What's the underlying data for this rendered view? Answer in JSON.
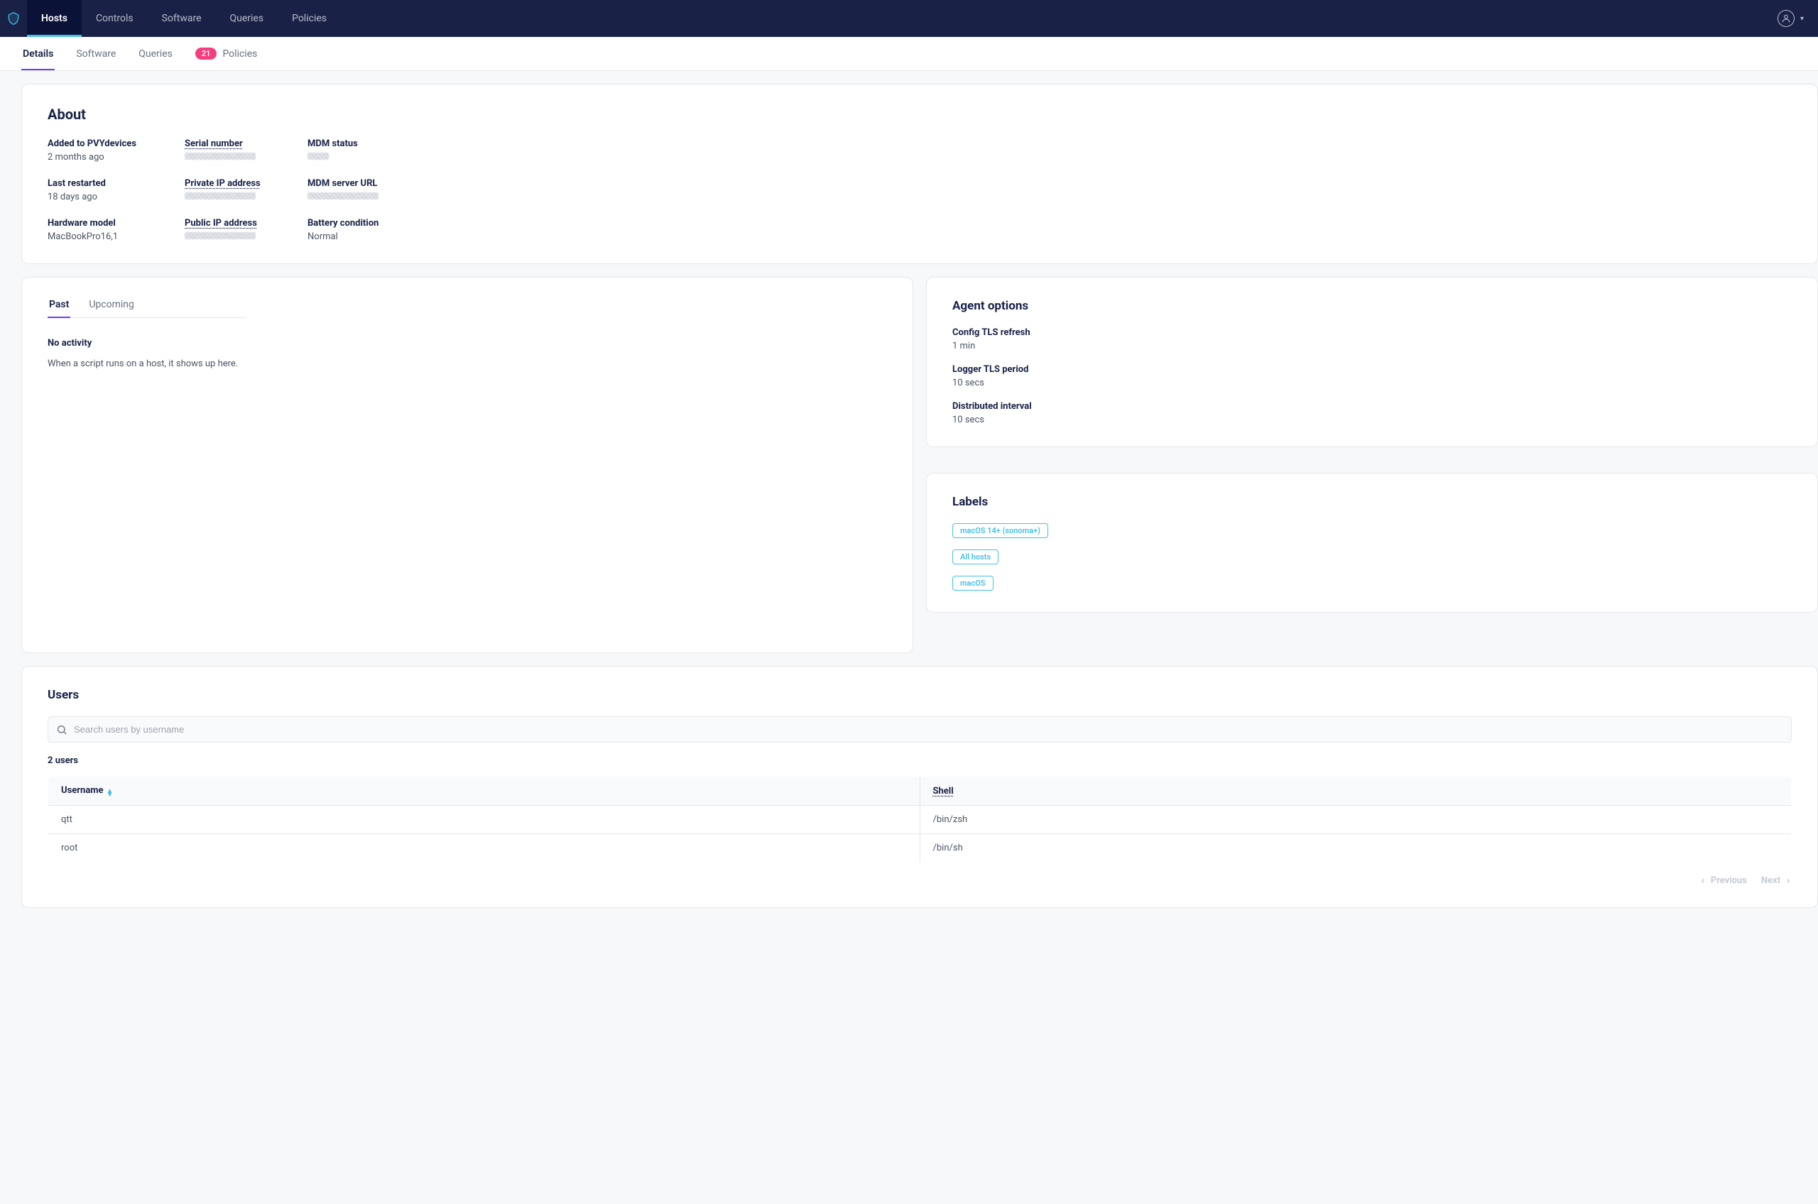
{
  "nav": {
    "items": [
      "Hosts",
      "Controls",
      "Software",
      "Queries",
      "Policies"
    ],
    "active": "Hosts"
  },
  "subnav": {
    "items": [
      {
        "label": "Details",
        "active": true
      },
      {
        "label": "Software"
      },
      {
        "label": "Queries"
      },
      {
        "label": "Policies",
        "badge": "21"
      }
    ]
  },
  "about": {
    "title": "About",
    "fields": {
      "added_label": "Added to PVYdevices",
      "added_value": "2 months ago",
      "serial_label": "Serial number",
      "mdm_status_label": "MDM status",
      "restarted_label": "Last restarted",
      "restarted_value": "18 days ago",
      "private_ip_label": "Private IP address",
      "mdm_url_label": "MDM server URL",
      "hw_label": "Hardware model",
      "hw_value": "MacBookPro16,1",
      "public_ip_label": "Public IP address",
      "battery_label": "Battery condition",
      "battery_value": "Normal"
    }
  },
  "activity": {
    "tab_past": "Past",
    "tab_upcoming": "Upcoming",
    "empty_title": "No activity",
    "empty_text": "When a script runs on a host, it shows up here."
  },
  "agent": {
    "title": "Agent options",
    "config_label": "Config TLS refresh",
    "config_value": "1 min",
    "logger_label": "Logger TLS period",
    "logger_value": "10 secs",
    "dist_label": "Distributed interval",
    "dist_value": "10 secs"
  },
  "labels": {
    "title": "Labels",
    "items": [
      "macOS 14+ (sonoma+)",
      "All hosts",
      "macOS"
    ]
  },
  "users": {
    "title": "Users",
    "search_placeholder": "Search users by username",
    "count": "2 users",
    "col_username": "Username",
    "col_shell": "Shell",
    "rows": [
      {
        "u": "qtt",
        "s": "/bin/zsh"
      },
      {
        "u": "root",
        "s": "/bin/sh"
      }
    ],
    "previous": "Previous",
    "next": "Next"
  }
}
